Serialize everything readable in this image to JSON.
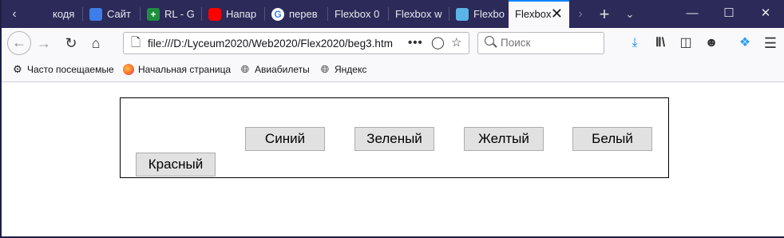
{
  "tabs": [
    {
      "label": "кодя",
      "favicon_color": "#2b2a58"
    },
    {
      "label": "Сайт",
      "favicon_color": "#3d7ee8"
    },
    {
      "label": "RL - G",
      "favicon_color": "#1e8e3e"
    },
    {
      "label": "Напар",
      "favicon_color": "#ff0000"
    },
    {
      "label": "перев",
      "favicon_color": "#ffffff"
    },
    {
      "label": "Flexbox 0",
      "favicon_color": ""
    },
    {
      "label": "Flexbox w",
      "favicon_color": ""
    },
    {
      "label": "Flexbo",
      "favicon_color": "#5ab4e6"
    },
    {
      "label": "Flexbox",
      "favicon_color": ""
    }
  ],
  "window_controls": {
    "minimize": "—",
    "maximize": "☐",
    "close": "✕"
  },
  "nav": {
    "url": "file:///D:/Lyceum2020/Web2020/Flex2020/beg3.htm",
    "page_actions": "•••",
    "search_placeholder": "Поиск"
  },
  "bookmarks": [
    {
      "label": "Часто посещаемые",
      "icon": "gear-icon"
    },
    {
      "label": "Начальная страница",
      "icon": "firefox-icon"
    },
    {
      "label": "Авиабилеты",
      "icon": "globe-icon"
    },
    {
      "label": "Яндекс",
      "icon": "globe-icon"
    }
  ],
  "page": {
    "buttons": [
      "Красный",
      "Синий",
      "Зеленый",
      "Желтый",
      "Белый"
    ]
  },
  "colors": {
    "tabbar": "#2b2a58",
    "active_tab_accent": "#0a84ff",
    "toolbar": "#f9f9fb",
    "download_blue": "#0a84ff"
  }
}
